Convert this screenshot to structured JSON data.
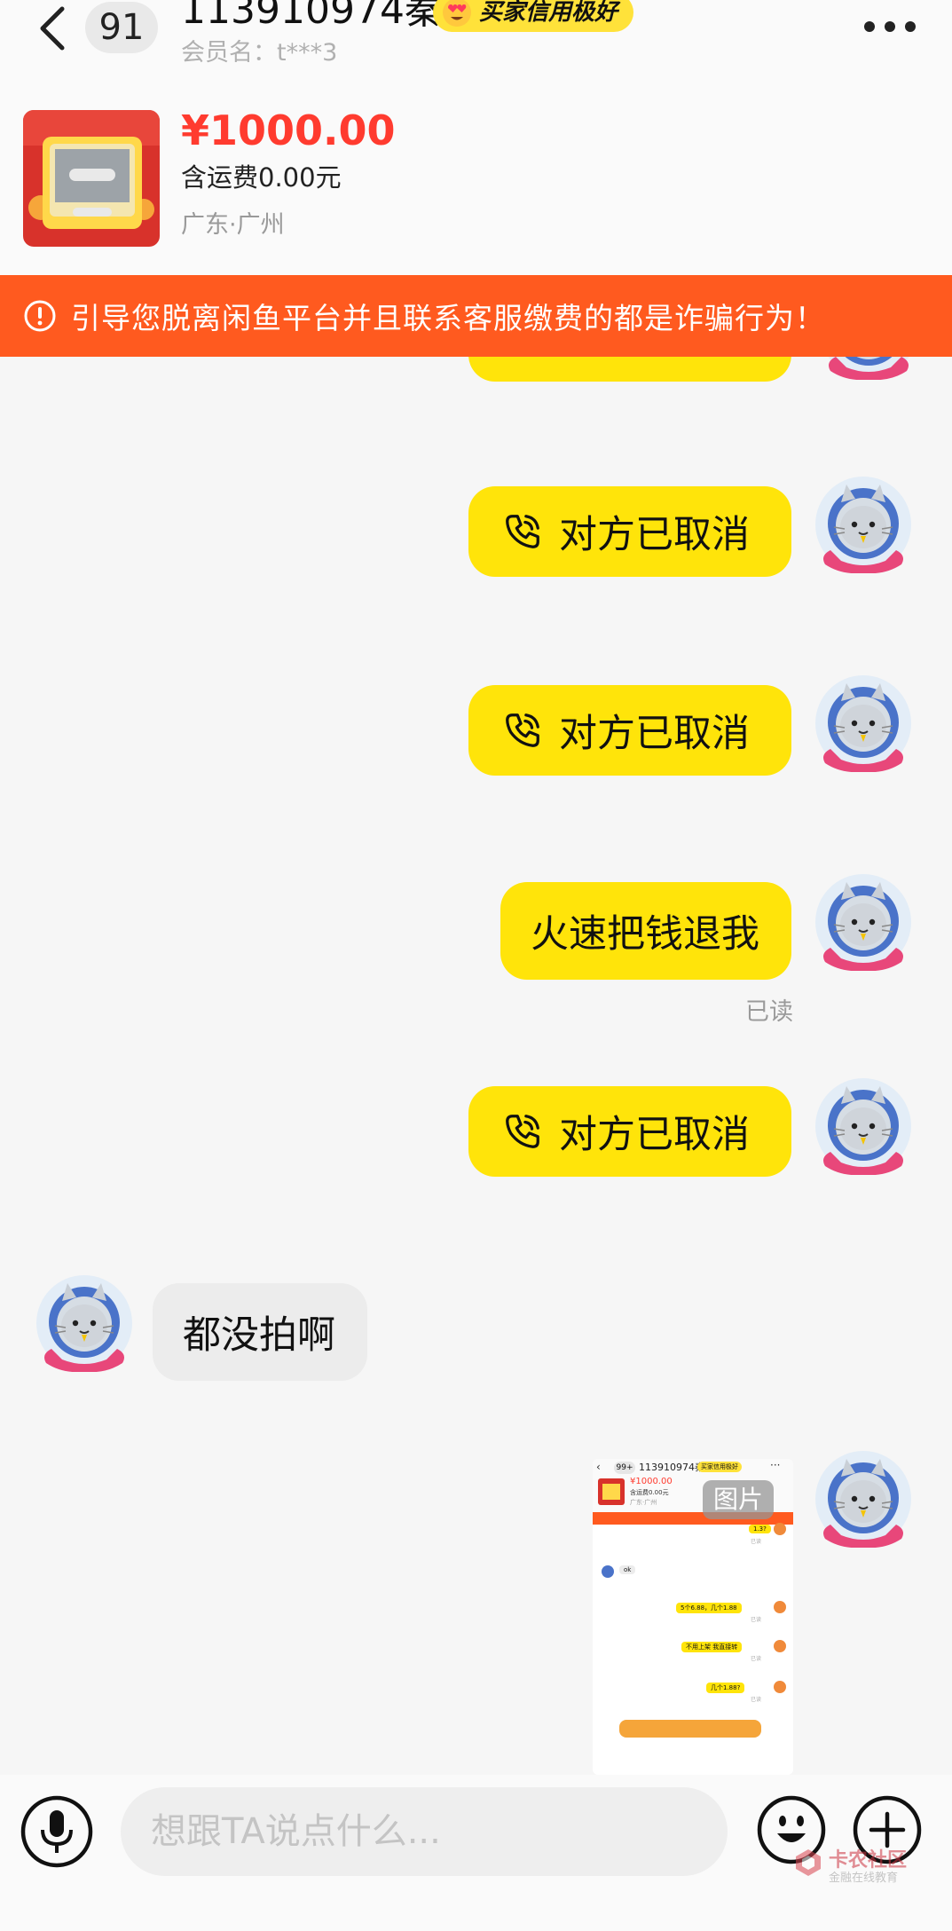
{
  "header": {
    "unread_count": "91",
    "contact_name": "113910974秦",
    "credit_badge": "买家信用极好",
    "member_name": "会员名：t***3"
  },
  "product": {
    "price": "¥1000.00",
    "shipping": "含运费0.00元",
    "location": "广东·广州"
  },
  "warning": {
    "text": "引导您脱离闲鱼平台并且联系客服缴费的都是诈骗行为！"
  },
  "messages": [
    {
      "side": "right",
      "type": "call",
      "text": "对方已取消"
    },
    {
      "side": "right",
      "type": "call",
      "text": "对方已取消"
    },
    {
      "side": "right",
      "type": "text",
      "text": "火速把钱退我",
      "status": "已读"
    },
    {
      "side": "right",
      "type": "call",
      "text": "对方已取消"
    },
    {
      "side": "left",
      "type": "text",
      "text": "都没拍啊"
    },
    {
      "side": "right",
      "type": "image",
      "label": "图片"
    }
  ],
  "screenshot_image": {
    "unread_count": "99+",
    "contact_name": "113910974秦",
    "credit_badge": "买家信用极好",
    "price": "¥1000.00",
    "shipping": "含运费0.00元",
    "location": "广东·广州",
    "lines": [
      {
        "side": "right",
        "text": "1.3?",
        "status": "已读"
      },
      {
        "side": "left",
        "text": "ok"
      },
      {
        "side": "right",
        "text": "5个6.88，几个1.88",
        "status": "已读"
      },
      {
        "side": "right",
        "text": "不用上架 我直接转",
        "status": "已读"
      },
      {
        "side": "right",
        "text": "几个1.88?",
        "status": "已读"
      }
    ]
  },
  "input": {
    "placeholder": "想跟TA说点什么..."
  },
  "watermark": {
    "title": "卡农社区",
    "subtitle": "金融在线教育"
  },
  "colors": {
    "accent_yellow": "#ffe40a",
    "warning_orange": "#ff5a1f",
    "price_red": "#ff3b2f",
    "avatar_blue": "#4a73c9"
  },
  "icons": {
    "back": "chevron-left-icon",
    "more": "more-dots-icon",
    "alert": "alert-circle-icon",
    "call": "phone-call-icon",
    "voice": "microphone-icon",
    "emoji": "smiley-icon",
    "add": "plus-circle-icon"
  }
}
